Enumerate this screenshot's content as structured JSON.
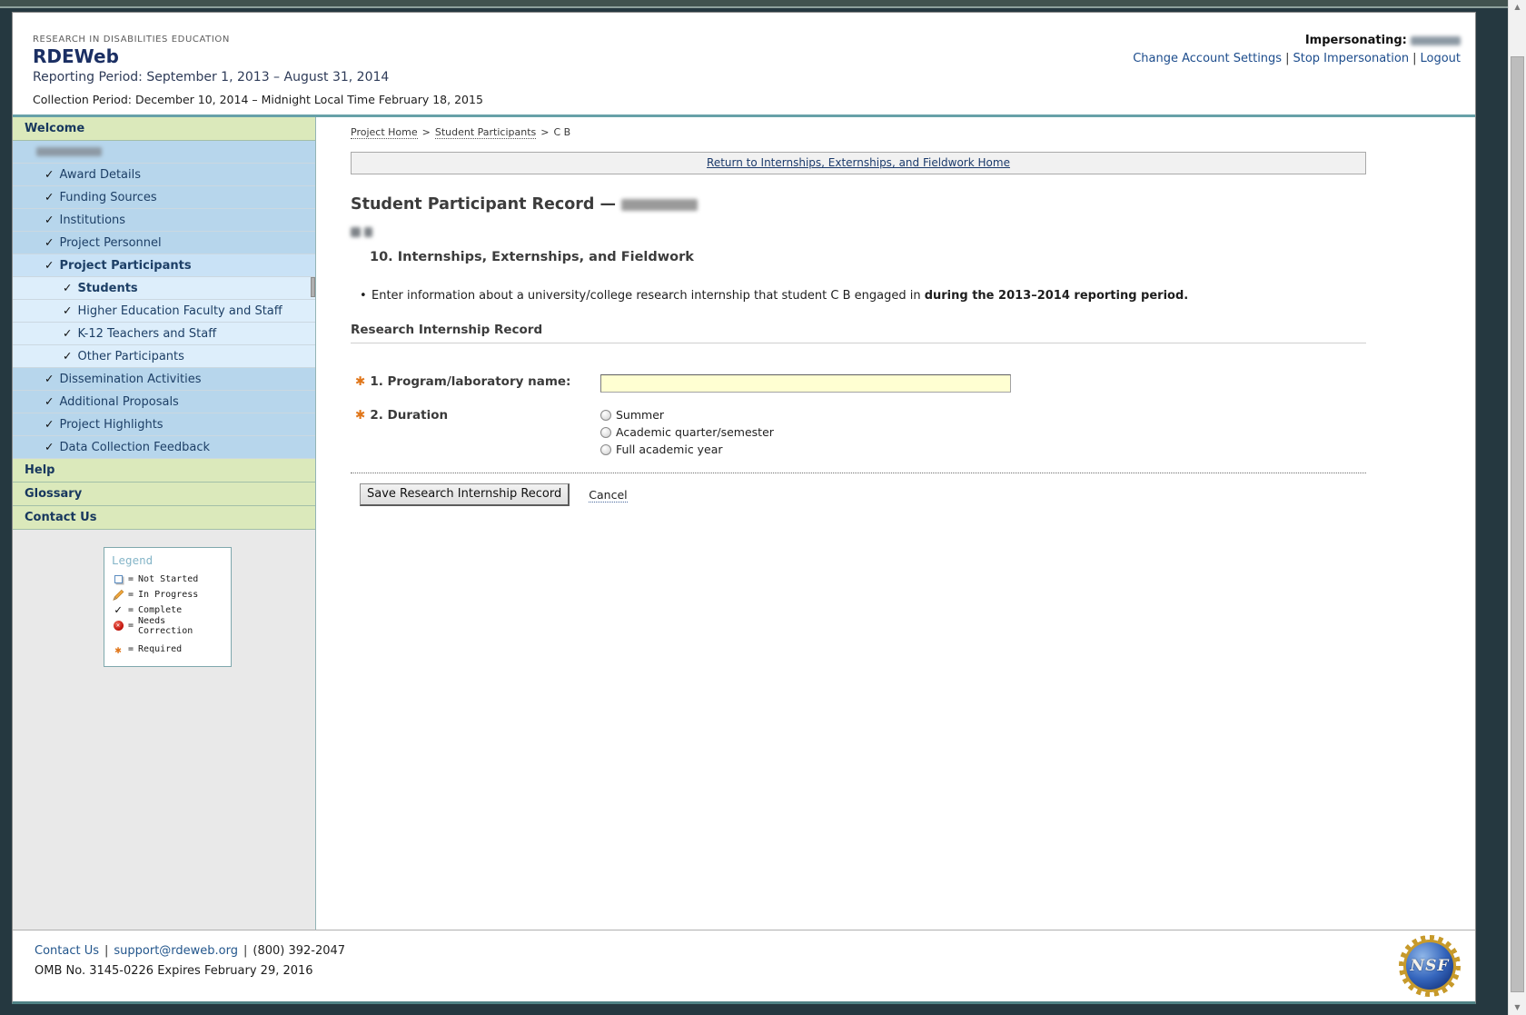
{
  "header": {
    "eyebrow": "RESEARCH IN DISABILITIES EDUCATION",
    "app_title": "RDEWeb",
    "reporting_period": "Reporting Period: September 1, 2013 – August 31, 2014",
    "collection_period": "Collection Period: December 10, 2014 – Midnight Local Time February 18, 2015",
    "impersonating_label": "Impersonating:",
    "links": {
      "change_account": "Change Account Settings",
      "stop_impersonation": "Stop Impersonation",
      "logout": "Logout"
    },
    "separator": "|"
  },
  "sidebar": {
    "items": [
      {
        "label": "Welcome"
      },
      {
        "label": ""
      },
      {
        "label": "Award Details"
      },
      {
        "label": "Funding Sources"
      },
      {
        "label": "Institutions"
      },
      {
        "label": "Project Personnel"
      },
      {
        "label": "Project Participants"
      },
      {
        "label": "Students"
      },
      {
        "label": "Higher Education Faculty and Staff"
      },
      {
        "label": "K-12 Teachers and Staff"
      },
      {
        "label": "Other Participants"
      },
      {
        "label": "Dissemination Activities"
      },
      {
        "label": "Additional Proposals"
      },
      {
        "label": "Project Highlights"
      },
      {
        "label": "Data Collection Feedback"
      },
      {
        "label": "Help"
      },
      {
        "label": "Glossary"
      },
      {
        "label": "Contact Us"
      }
    ]
  },
  "legend": {
    "title": "Legend",
    "equals": "=",
    "items": [
      {
        "icon": "square-icon",
        "label": "Not Started"
      },
      {
        "icon": "pencil-icon",
        "label": "In Progress"
      },
      {
        "icon": "check-icon",
        "label": "Complete"
      },
      {
        "icon": "error-icon",
        "label": "Needs Correction"
      },
      {
        "icon": "asterisk-icon",
        "label": "Required"
      }
    ]
  },
  "breadcrumb": {
    "separator": ">",
    "items": [
      {
        "label": "Project Home"
      },
      {
        "label": "Student Participants"
      },
      {
        "label": "C B"
      }
    ]
  },
  "main": {
    "return_link": "Return to Internships, Externships, and Fieldwork Home",
    "title": "Student Participant Record —",
    "section_title": "10. Internships, Externships, and Fieldwork",
    "instruction_normal": "Enter information about a university/college research internship that student C B engaged in ",
    "instruction_bold": "during the 2013–2014 reporting period.",
    "record_heading": "Research Internship Record",
    "form": {
      "q1_label": "1. Program/laboratory name:",
      "q1_value": "",
      "q2_label": "2. Duration",
      "duration_options": [
        {
          "label": "Summer"
        },
        {
          "label": "Academic quarter/semester"
        },
        {
          "label": "Full academic year"
        }
      ],
      "save_button": "Save Research Internship Record",
      "cancel_link": "Cancel"
    }
  },
  "footer": {
    "contact_link": "Contact Us",
    "email_link": "support@rdeweb.org",
    "phone": "(800) 392-2047",
    "separator": "|",
    "omb": "OMB No. 3145-0226 Expires February 29, 2016",
    "nsf_logo_text": "NSF"
  },
  "colors": {
    "accent_teal": "#67a1a8",
    "nav_blue": "#b7d6ec",
    "nav_blue_selected": "#c9e2f6",
    "nav_blue_sub": "#ddeefb",
    "nav_green": "#dbe9bb",
    "required_orange": "#e0761a",
    "input_yellow": "#ffffd2",
    "link_navy": "#1c4c8c"
  }
}
